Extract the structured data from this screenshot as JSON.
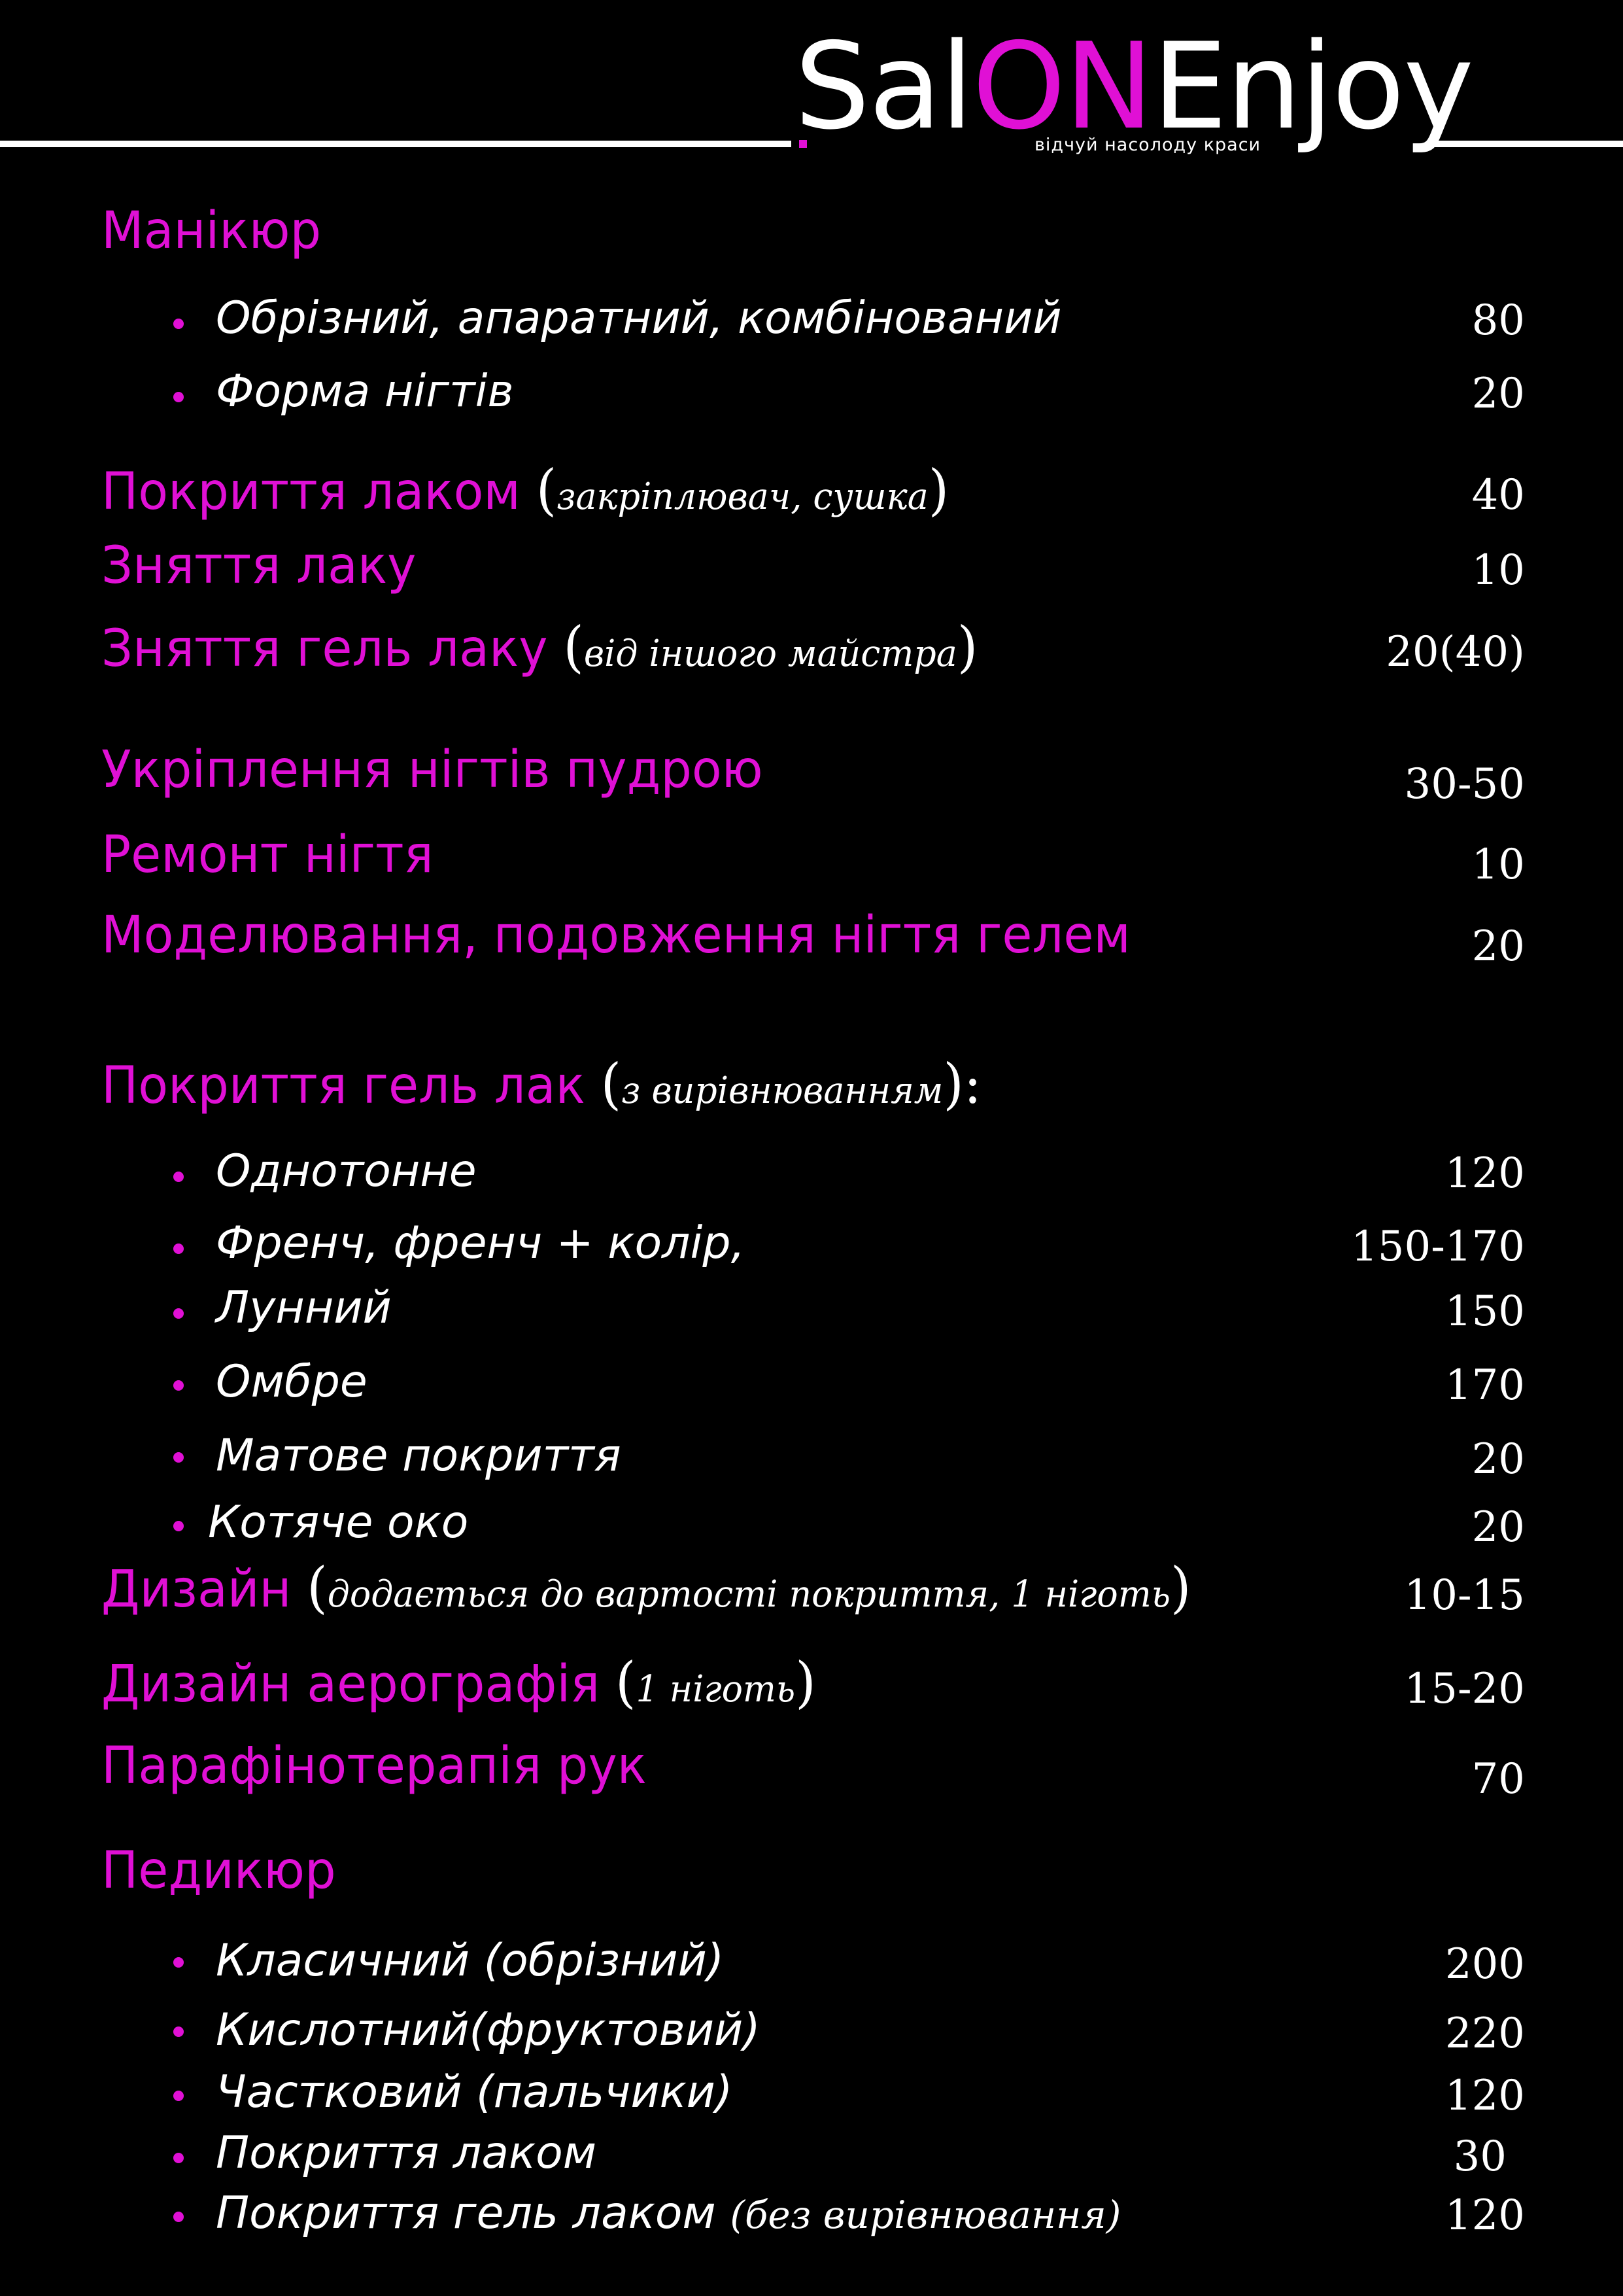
{
  "header": {
    "logo_part1": "Sal",
    "logo_part2": "ON",
    "logo_part3": "Enjoy",
    "tagline": "відчуй насолоду краси",
    "brand_color": "#e010d5"
  },
  "manicure": {
    "title": "Манікюр",
    "items": [
      {
        "label": "Обрізний, апаратний, комбінований",
        "price": "80"
      },
      {
        "label": "Форма нігтів",
        "price": "20"
      }
    ]
  },
  "services1": [
    {
      "label": "Покриття лаком",
      "note": "закріплювач, сушка",
      "price": "40"
    },
    {
      "label": "Зняття лаку",
      "price": "10"
    },
    {
      "label": "Зняття гель лаку",
      "note": "від іншого майстра",
      "price": "20(40)"
    },
    {
      "label": "Укріплення нігтів пудрою",
      "price": "30-50"
    },
    {
      "label": "Ремонт нігтя",
      "price": "10"
    },
    {
      "label": "Моделювання, подовження нігтя гелем",
      "price": "20"
    }
  ],
  "gel": {
    "title": "Покриття гель лак",
    "note": "з вирівнюванням",
    "suffix": ":",
    "items": [
      {
        "label": "Однотонне",
        "price": "120"
      },
      {
        "label": "Френч, френч + колір,",
        "price": "150-170"
      },
      {
        "label": "Лунний",
        "price": "150"
      },
      {
        "label": "Омбре",
        "price": "170"
      },
      {
        "label": "Матове покриття",
        "price": "20"
      },
      {
        "label": "Котяче око",
        "price": "20"
      }
    ]
  },
  "services2": [
    {
      "label": "Дизайн",
      "note": "додається до вартості покриття, 1 ніготь",
      "price": "10-15"
    },
    {
      "label": "Дизайн аерографія",
      "note": "1 ніготь",
      "price": "15-20"
    },
    {
      "label": "Парафінотерапія рук",
      "price": "70"
    }
  ],
  "pedicure": {
    "title": "Педикюр",
    "items": [
      {
        "label": "Класичний (обрізний)",
        "price": "200"
      },
      {
        "label": "Кислотний(фруктовий)",
        "price": "220"
      },
      {
        "label": "Частковий (пальчики)",
        "price": "120"
      },
      {
        "label": "Покриття лаком",
        "price": "30"
      },
      {
        "label": "Покриття гель лаком",
        "note": "(без вирівнювання)",
        "price": "120"
      }
    ]
  }
}
